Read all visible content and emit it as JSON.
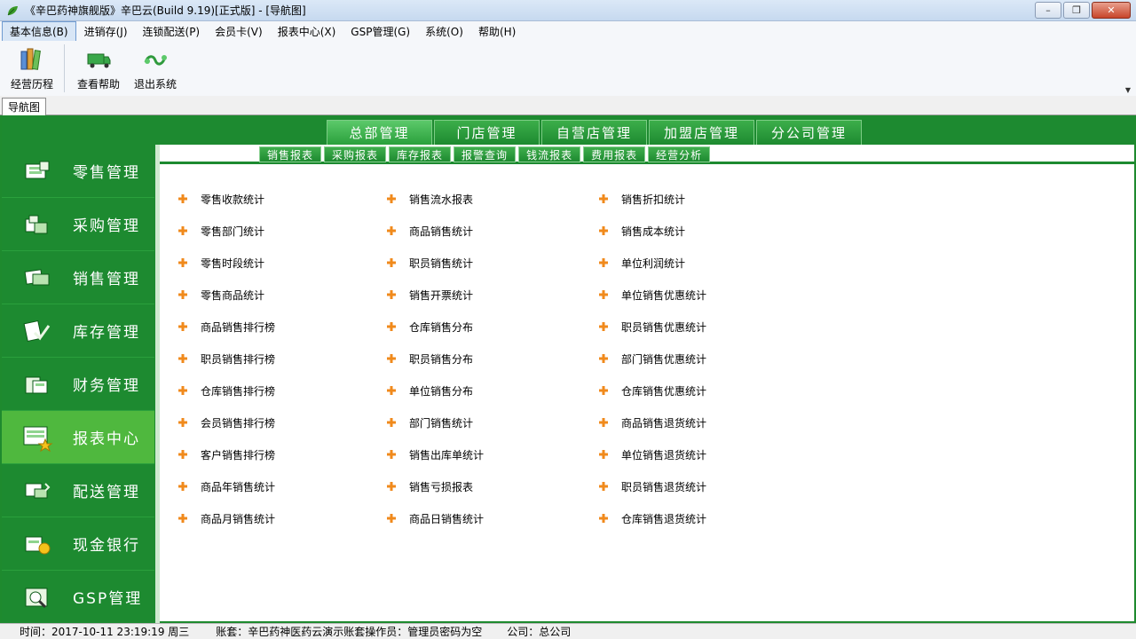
{
  "window": {
    "title": "《辛巴药神旗舰版》辛巴云(Build 9.19)[正式版] - [导航图]",
    "controls": {
      "minimize": "–",
      "maximize": "❐",
      "close": "✕"
    }
  },
  "menubar": {
    "items": [
      {
        "label": "基本信息(B)",
        "active": true
      },
      {
        "label": "进销存(J)"
      },
      {
        "label": "连锁配送(P)"
      },
      {
        "label": "会员卡(V)"
      },
      {
        "label": "报表中心(X)"
      },
      {
        "label": "GSP管理(G)"
      },
      {
        "label": "系统(O)"
      },
      {
        "label": "帮助(H)"
      }
    ]
  },
  "toolbar": {
    "buttons": [
      {
        "label": "经营历程",
        "icon": "books-icon"
      },
      {
        "label": "查看帮助",
        "icon": "truck-icon"
      },
      {
        "label": "退出系统",
        "icon": "link-icon"
      }
    ],
    "overflow_arrow": "▼"
  },
  "doc_tab": {
    "label": "导航图"
  },
  "module_tabs": [
    {
      "label": "总部管理",
      "active": true
    },
    {
      "label": "门店管理"
    },
    {
      "label": "自营店管理"
    },
    {
      "label": "加盟店管理"
    },
    {
      "label": "分公司管理"
    }
  ],
  "sub_tabs": [
    "销售报表",
    "采购报表",
    "库存报表",
    "报警查询",
    "钱流报表",
    "费用报表",
    "经营分析"
  ],
  "sidebar": {
    "items": [
      {
        "label": "零售管理",
        "icon": "retail-icon"
      },
      {
        "label": "采购管理",
        "icon": "purchase-icon"
      },
      {
        "label": "销售管理",
        "icon": "sales-icon"
      },
      {
        "label": "库存管理",
        "icon": "inventory-icon"
      },
      {
        "label": "财务管理",
        "icon": "finance-icon"
      },
      {
        "label": "报表中心",
        "icon": "report-icon",
        "active": true
      },
      {
        "label": "配送管理",
        "icon": "delivery-icon"
      },
      {
        "label": "现金银行",
        "icon": "cash-icon"
      },
      {
        "label": "GSP管理",
        "icon": "gsp-icon"
      }
    ]
  },
  "reports": {
    "col1": [
      "零售收款统计",
      "零售部门统计",
      "零售时段统计",
      "零售商品统计",
      "商品销售排行榜",
      "职员销售排行榜",
      "仓库销售排行榜",
      "会员销售排行榜",
      "客户销售排行榜",
      "商品年销售统计",
      "商品月销售统计"
    ],
    "col2": [
      "销售流水报表",
      "商品销售统计",
      "职员销售统计",
      "销售开票统计",
      "仓库销售分布",
      "职员销售分布",
      "单位销售分布",
      "部门销售统计",
      "销售出库单统计",
      "销售亏损报表",
      "商品日销售统计"
    ],
    "col3": [
      "销售折扣统计",
      "销售成本统计",
      "单位利润统计",
      "单位销售优惠统计",
      "职员销售优惠统计",
      "部门销售优惠统计",
      "仓库销售优惠统计",
      "商品销售退货统计",
      "单位销售退货统计",
      "职员销售退货统计",
      "仓库销售退货统计"
    ]
  },
  "statusbar": {
    "time": "时间：2017-10-11 23:19:19 周三",
    "account": "账套：辛巴药神医药云演示账套",
    "operator": "操作员：管理员密码为空",
    "company": "公司：总公司"
  },
  "colors": {
    "brand_green": "#1d8a30",
    "active_green": "#4fb83e",
    "accent_orange": "#f08a1c"
  }
}
